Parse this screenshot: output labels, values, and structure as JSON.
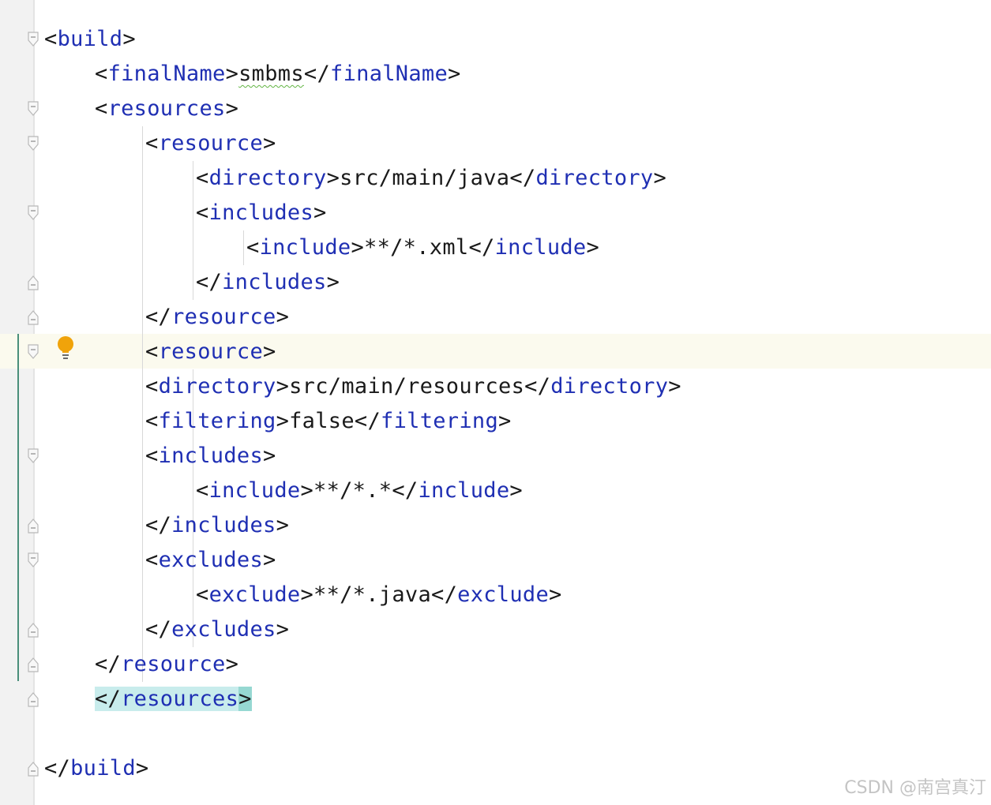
{
  "editor": {
    "lines": [
      {
        "indent": 0,
        "tag": "build",
        "kind": "open"
      },
      {
        "indent": 1,
        "tag": "finalName",
        "kind": "element",
        "value": "smbms"
      },
      {
        "indent": 1,
        "tag": "resources",
        "kind": "open"
      },
      {
        "indent": 2,
        "tag": "resource",
        "kind": "open"
      },
      {
        "indent": 3,
        "tag": "directory",
        "kind": "element",
        "value": "src/main/java"
      },
      {
        "indent": 3,
        "tag": "includes",
        "kind": "open"
      },
      {
        "indent": 4,
        "tag": "include",
        "kind": "element",
        "value": "**/*.xml"
      },
      {
        "indent": 3,
        "tag": "includes",
        "kind": "close"
      },
      {
        "indent": 2,
        "tag": "resource",
        "kind": "close"
      },
      {
        "indent": 2,
        "tag": "resource",
        "kind": "open"
      },
      {
        "indent": 2,
        "tag": "directory",
        "kind": "element",
        "value": "src/main/resources"
      },
      {
        "indent": 2,
        "tag": "filtering",
        "kind": "element",
        "value": "false"
      },
      {
        "indent": 2,
        "tag": "includes",
        "kind": "open"
      },
      {
        "indent": 3,
        "tag": "include",
        "kind": "element",
        "value": "**/*.*"
      },
      {
        "indent": 2,
        "tag": "includes",
        "kind": "close"
      },
      {
        "indent": 2,
        "tag": "excludes",
        "kind": "open"
      },
      {
        "indent": 3,
        "tag": "exclude",
        "kind": "element",
        "value": "**/*.java"
      },
      {
        "indent": 2,
        "tag": "excludes",
        "kind": "close"
      },
      {
        "indent": 1,
        "tag": "resource",
        "kind": "close"
      },
      {
        "indent": 1,
        "tag": "resources",
        "kind": "close"
      },
      {
        "indent": 0,
        "tag": "",
        "kind": "blank"
      },
      {
        "indent": 0,
        "tag": "build",
        "kind": "close"
      }
    ],
    "caret_line": 10,
    "highlighted_tag_lines": [
      10,
      19
    ],
    "intention_icon": "lightbulb-icon",
    "colors": {
      "tag": "#1f2fb3",
      "text": "#1a1a1a",
      "match_highlight": "#c8ecec",
      "caret_row": "#fbfaee",
      "bulb": "#f0a30a"
    }
  },
  "watermark": "CSDN @南宫真汀"
}
